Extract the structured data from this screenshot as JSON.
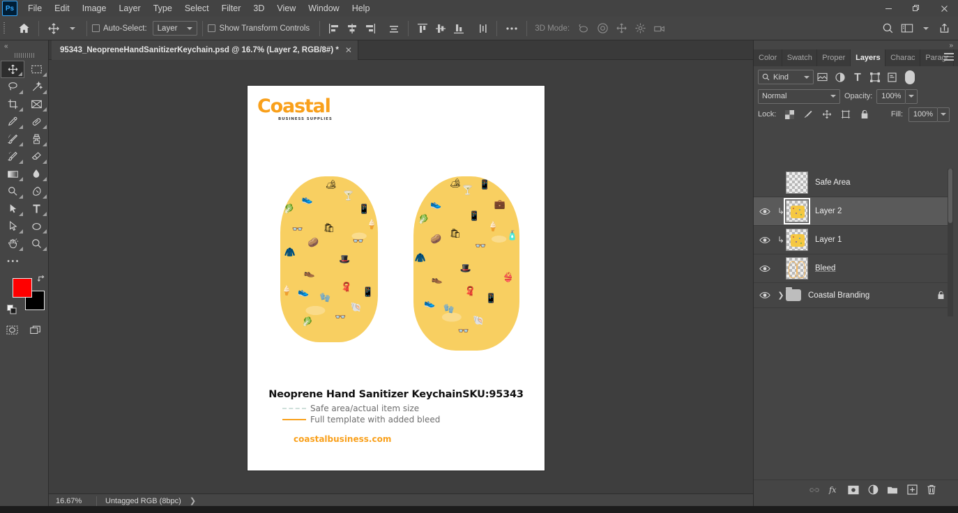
{
  "app": {
    "logo_text": "Ps",
    "menu": [
      "File",
      "Edit",
      "Image",
      "Layer",
      "Type",
      "Select",
      "Filter",
      "3D",
      "View",
      "Window",
      "Help"
    ],
    "window_controls": {
      "minimize": "minimize-icon",
      "restore": "restore-icon",
      "close": "close-icon"
    }
  },
  "options_bar": {
    "home_icon": "home-icon",
    "tool_icon": "move-tool-icon",
    "auto_select_label": "Auto-Select:",
    "auto_select_checked": false,
    "auto_select_target": "Layer",
    "show_transform_label": "Show Transform Controls",
    "show_transform_checked": false,
    "align_icons": [
      "align-left-edges-icon",
      "align-horizontal-centers-icon",
      "align-right-edges-icon",
      "distribute-horizontally-icon"
    ],
    "align_icons2": [
      "align-top-edges-icon",
      "align-vertical-centers-icon",
      "align-bottom-edges-icon",
      "distribute-vertically-icon"
    ],
    "more_icon": "more-options-icon",
    "mode_3d_label": "3D Mode:",
    "mode_3d_icons": [
      "orbit-3d-icon",
      "roll-3d-icon",
      "pan-3d-icon",
      "slide-3d-icon",
      "camera-3d-icon"
    ],
    "right_icons": [
      "search-icon",
      "workspace-icon",
      "chevron-down-icon",
      "share-icon"
    ]
  },
  "toolbar": {
    "collapse_label": "«",
    "tools": [
      {
        "name": "move-tool",
        "glyph": "move",
        "active": true
      },
      {
        "name": "rectangular-marquee-tool",
        "glyph": "marquee"
      },
      {
        "name": "lasso-tool",
        "glyph": "lasso"
      },
      {
        "name": "object-selection-tool",
        "glyph": "wand"
      },
      {
        "name": "crop-tool",
        "glyph": "crop"
      },
      {
        "name": "frame-tool",
        "glyph": "frame"
      },
      {
        "name": "eyedropper-tool",
        "glyph": "eyedropper"
      },
      {
        "name": "healing-brush-tool",
        "glyph": "healing"
      },
      {
        "name": "brush-tool",
        "glyph": "brush"
      },
      {
        "name": "clone-stamp-tool",
        "glyph": "stamp"
      },
      {
        "name": "history-brush-tool",
        "glyph": "historybrush"
      },
      {
        "name": "eraser-tool",
        "glyph": "eraser"
      },
      {
        "name": "gradient-tool",
        "glyph": "gradient"
      },
      {
        "name": "blur-tool",
        "glyph": "blur"
      },
      {
        "name": "dodge-tool",
        "glyph": "dodge"
      },
      {
        "name": "pen-tool",
        "glyph": "pen"
      },
      {
        "name": "path-selection-tool",
        "glyph": "pathselect"
      },
      {
        "name": "type-tool",
        "glyph": "type"
      },
      {
        "name": "direct-selection-tool",
        "glyph": "directselect"
      },
      {
        "name": "ellipse-tool",
        "glyph": "ellipse"
      },
      {
        "name": "hand-tool",
        "glyph": "hand"
      },
      {
        "name": "zoom-tool",
        "glyph": "zoom"
      },
      {
        "name": "edit-toolbar",
        "glyph": "dots"
      }
    ],
    "foreground_color": "#ff0000",
    "background_color": "#000000",
    "quick_mask_icon": "quick-mask-icon",
    "screen_mode_icon": "screen-mode-icon"
  },
  "document": {
    "tab_title": "95343_NeopreneHandSanitizerKeychain.psd @ 16.7% (Layer 2, RGB/8#) *",
    "close_icon": "close-icon"
  },
  "artboard": {
    "brand_name": "Coastal",
    "brand_tagline": "BUSINESS SUPPLIES",
    "brand_color": "#f9a01b",
    "product_title": "Neoprene Hand Sanitizer Keychain",
    "sku_label": "SKU:95343",
    "legend_safe_area": "Safe area/actual item size",
    "legend_bleed": "Full template with added bleed",
    "url": "coastalbusiness.com",
    "pattern_base_color": "#f8cf61",
    "pattern_theme": "beach-summer-items",
    "pattern_icons": [
      "flip-flops",
      "sunglasses",
      "ice-cream",
      "beach-bag",
      "sun-hat",
      "swimsuit",
      "mobile-phone",
      "cocktail-drink",
      "sandals",
      "shell",
      "swim-trunks",
      "bikini",
      "sunscreen",
      "towel",
      "goggles"
    ]
  },
  "status_bar": {
    "zoom_level": "16.67%",
    "doc_info": "Untagged RGB (8bpc)",
    "arrow_icon": "chevron-right-icon"
  },
  "right_panel": {
    "collapse_label": "»",
    "tabs": [
      {
        "label": "Color",
        "active": false
      },
      {
        "label": "Swatch",
        "active": false
      },
      {
        "label": "Proper",
        "active": false
      },
      {
        "label": "Layers",
        "active": true
      },
      {
        "label": "Charac",
        "active": false
      },
      {
        "label": "Paragr",
        "active": false
      }
    ],
    "panel_menu_icon": "panel-menu-icon",
    "filter": {
      "search_icon": "search-icon",
      "kind_label": "Kind",
      "filter_icons": [
        "filter-pixel-icon",
        "filter-adjustment-icon",
        "filter-type-icon",
        "filter-shape-icon",
        "filter-smart-object-icon"
      ],
      "toggle_icon": "filter-toggle-switch"
    },
    "blend": {
      "mode_label": "Normal",
      "opacity_label": "Opacity:",
      "opacity_value": "100%",
      "fill_label": "Fill:",
      "fill_value": "100%"
    },
    "lock": {
      "label": "Lock:",
      "icons": [
        "lock-transparent-pixels-icon",
        "lock-image-pixels-icon",
        "lock-position-icon",
        "lock-artboard-nesting-icon",
        "lock-all-icon"
      ]
    },
    "layers": [
      {
        "name": "Safe Area",
        "visible": false,
        "clipped": false,
        "selected": false,
        "locked": false,
        "type": "pixel",
        "thumb": "empty"
      },
      {
        "name": "Layer 2",
        "visible": true,
        "clipped": true,
        "selected": true,
        "locked": false,
        "type": "pixel",
        "thumb": "pattern"
      },
      {
        "name": "Layer 1",
        "visible": true,
        "clipped": true,
        "selected": false,
        "locked": false,
        "type": "pixel",
        "thumb": "pattern"
      },
      {
        "name": "Bleed",
        "visible": true,
        "clipped": false,
        "selected": false,
        "locked": false,
        "type": "pixel",
        "thumb": "bleed"
      },
      {
        "name": "Coastal Branding",
        "visible": true,
        "clipped": false,
        "selected": false,
        "locked": true,
        "type": "group",
        "thumb": "folder"
      }
    ],
    "footer_icons": [
      "link-layers-icon",
      "layer-effects-icon",
      "layer-mask-icon",
      "adjustment-layer-icon",
      "new-group-icon",
      "new-layer-icon",
      "delete-layer-icon"
    ]
  }
}
